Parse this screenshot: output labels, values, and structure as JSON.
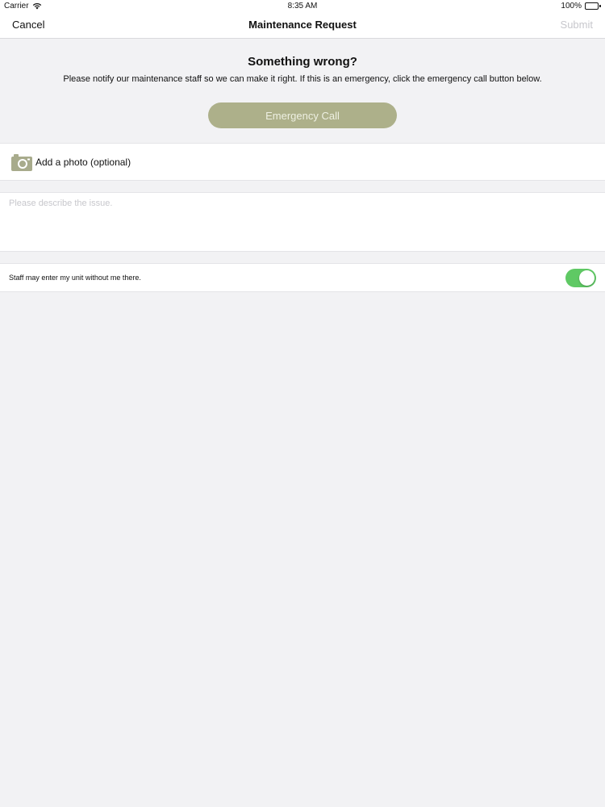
{
  "status_bar": {
    "carrier": "Carrier",
    "time": "8:35 AM",
    "battery": "100%",
    "wifi_icon": "wifi-icon",
    "battery_icon": "battery-icon"
  },
  "nav": {
    "cancel_label": "Cancel",
    "title": "Maintenance Request",
    "submit_label": "Submit"
  },
  "header": {
    "title": "Something wrong?",
    "text": "Please notify our maintenance staff so we can make it right. If this is an emergency, click the emergency call button below."
  },
  "emergency": {
    "label": "Emergency Call"
  },
  "photo": {
    "icon": "camera-icon",
    "label": "Add a photo (optional)"
  },
  "description": {
    "placeholder": "Please describe the issue.",
    "value": ""
  },
  "permission": {
    "label": "Staff may enter my unit without me there.",
    "enabled": true
  },
  "colors": {
    "accent": "#adb08a",
    "toggle_on": "#5fc964",
    "disabled_text": "#c7c7cc",
    "background": "#f2f2f4"
  }
}
